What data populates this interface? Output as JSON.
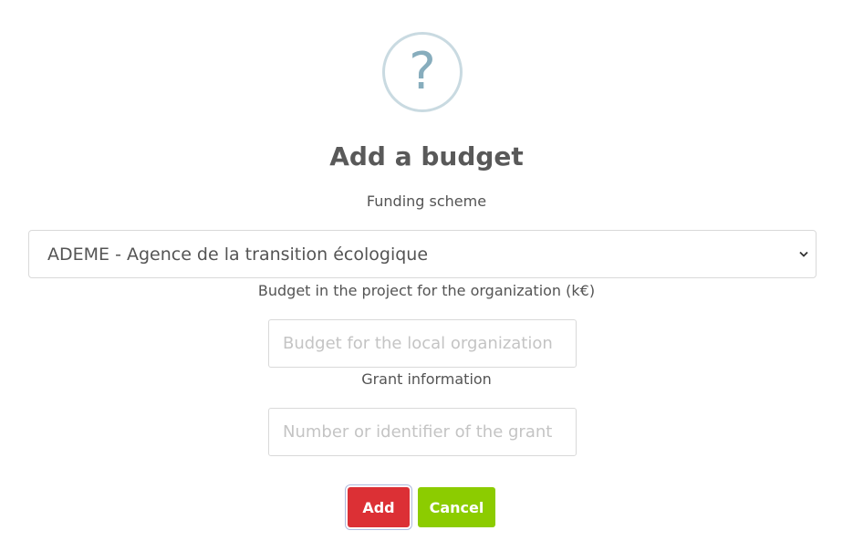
{
  "dialog": {
    "icon": "question-mark-icon",
    "icon_glyph": "?",
    "title": "Add a budget",
    "funding_scheme": {
      "label": "Funding scheme",
      "selected": "ADEME - Agence de la transition écologique"
    },
    "budget": {
      "label": "Budget in the project for the organization (k€)",
      "placeholder": "Budget for the local organization"
    },
    "grant": {
      "label": "Grant information",
      "placeholder": "Number or identifier of the grant"
    },
    "buttons": {
      "add": "Add",
      "cancel": "Cancel"
    },
    "colors": {
      "add_button": "#dc3035",
      "cancel_button": "#8ccc00",
      "icon_ring": "#c9dae1"
    }
  }
}
